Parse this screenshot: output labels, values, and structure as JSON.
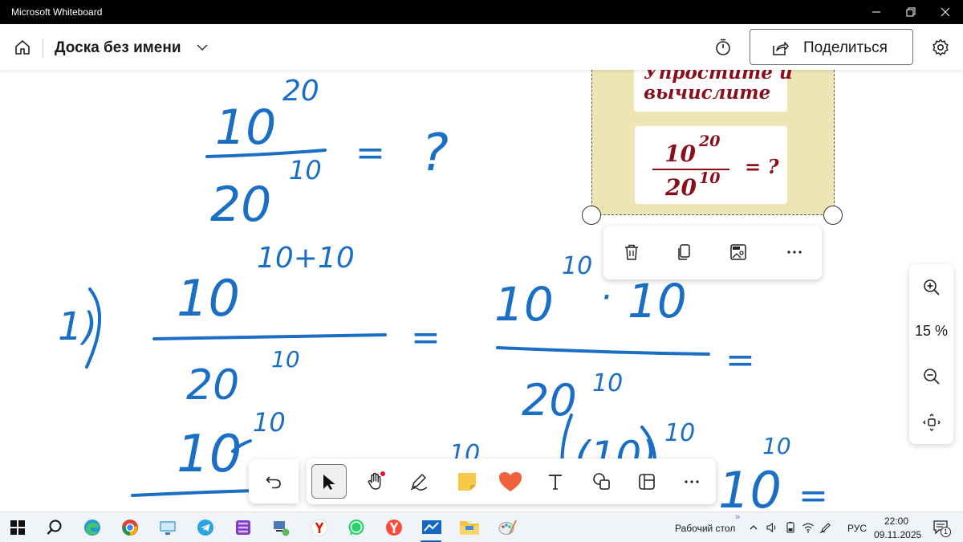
{
  "window": {
    "title": "Microsoft Whiteboard",
    "controls": {
      "minimize": "minimize-icon",
      "restore": "restore-icon",
      "close": "close-icon"
    }
  },
  "header": {
    "board_name": "Доска без имени",
    "share_label": "Поделиться",
    "icons": [
      "home-icon",
      "chevron-down-icon",
      "timer-icon",
      "share-icon",
      "gear-icon"
    ]
  },
  "image_card": {
    "title_line1": "Упростите и",
    "title_line2": "вычислите",
    "formula": {
      "base_top": "10",
      "exp_top": "20",
      "base_bottom": "20",
      "exp_bottom": "10",
      "rhs": "= ?"
    },
    "colors": {
      "background": "#efe4b4",
      "text": "#8a0f1d"
    }
  },
  "context_toolbar": {
    "icons": [
      "trash-icon",
      "copy-icon",
      "image-options-icon",
      "more-icon"
    ]
  },
  "zoom": {
    "level": "15 %",
    "icons": [
      "zoom-in-icon",
      "zoom-out-icon",
      "fit-view-icon"
    ]
  },
  "toolbar": {
    "icons": [
      "undo-icon",
      "select-icon",
      "pan-hand-icon",
      "pen-icon",
      "sticky-note-icon",
      "reaction-heart-icon",
      "text-icon",
      "shapes-icon",
      "templates-icon",
      "more-icon"
    ],
    "active_tool": "select",
    "colors": {
      "sticky": "#f7c948",
      "heart": "#f0623c",
      "notify_dot": "#e81123"
    }
  },
  "ink": {
    "color": "#1a6fc4",
    "eq1": {
      "base_top": "10",
      "exp_top": "20",
      "base_bottom": "20",
      "exp_bottom": "10",
      "eq": "=",
      "rhs": "?"
    },
    "eq2": {
      "step": "1)",
      "base_top": "10",
      "exp_top": "10+10",
      "base_bottom": "20",
      "exp_bottom": "10",
      "eq": "="
    },
    "eq3": {
      "top_a": "10",
      "exp_a": "10",
      "dot": "·",
      "top_b": "10",
      "base_bottom": "20",
      "exp_bottom": "10",
      "eq": "="
    },
    "eq4": {
      "partial_a": "10",
      "exp_a": "10",
      "partial_b": "10",
      "exp_b": "10",
      "partial_c": "(10)",
      "exp_c": "10",
      "partial_d": "10",
      "exp_d": "10",
      "eq": "="
    }
  },
  "taskbar": {
    "apps": [
      "windows-start-icon",
      "search-icon",
      "edge-icon",
      "chrome-icon",
      "remote-desktop-icon",
      "telegram-icon",
      "onenote-icon",
      "network-app-icon",
      "yandex-icon",
      "whatsapp-icon",
      "yandex-browser-icon",
      "whiteboard-icon",
      "file-explorer-icon",
      "paint-icon"
    ],
    "desktop_label": "Рабочий стол",
    "language": "РУС",
    "time": "22:00",
    "date": "09.11.2025",
    "notifications": "1",
    "tray": [
      "chevron-up-icon",
      "volume-icon",
      "battery-icon",
      "wifi-icon",
      "pen-tray-icon"
    ]
  }
}
